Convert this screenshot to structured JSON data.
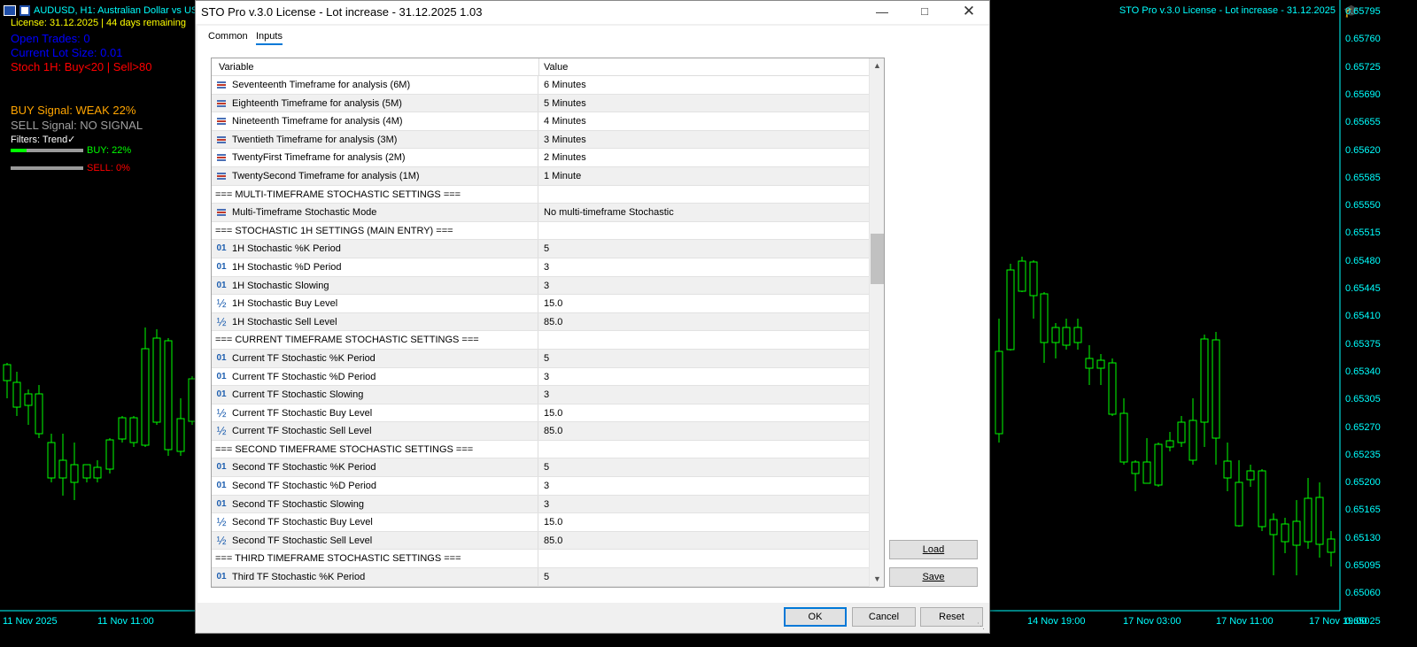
{
  "chart": {
    "header_text": "AUDUSD, H1:  Australian Dollar vs US",
    "license_text": "License: 31.12.2025 | 44 days remaining",
    "open_trades": "Open Trades: 0",
    "lot_size": "Current Lot Size: 0.01",
    "stoch_text": "Stoch 1H: Buy<20 | Sell>80",
    "buy_signal": "BUY Signal: WEAK 22%",
    "sell_signal": "SELL Signal: NO SIGNAL",
    "filters": "Filters: Trend✓",
    "buy_label": "BUY: 22%",
    "buy_percent": 22,
    "sell_label": "SELL: 0%",
    "sell_percent": 0,
    "ea_title": "STO Pro v.3.0 License - Lot increase - 31.12.2025",
    "colors": {
      "background": "#000000",
      "axis_text": "#00ffff",
      "license": "#ffff00",
      "open_trades": "#0000ff",
      "stoch": "#ff0000",
      "buy_signal": "#ffa500",
      "sell_signal": "#a0a0a0",
      "filters": "#ffffff",
      "buy": "#00ff00",
      "sell": "#ff0000",
      "candle": "#00ff00"
    },
    "price_labels": [
      "0.65795",
      "0.65760",
      "0.65725",
      "0.65690",
      "0.65655",
      "0.65620",
      "0.65585",
      "0.65550",
      "0.65515",
      "0.65480",
      "0.65445",
      "0.65410",
      "0.65375",
      "0.65340",
      "0.65305",
      "0.65270",
      "0.65235",
      "0.65200",
      "0.65165",
      "0.65130",
      "0.65095",
      "0.65060",
      "0.65025"
    ],
    "time_labels_left": [
      "11 Nov 2025",
      "11 Nov 11:00"
    ],
    "time_labels_right": [
      "14 Nov 19:00",
      "17 Nov 03:00",
      "17 Nov 11:00",
      "17 Nov 19:00"
    ]
  },
  "dialog": {
    "title": "STO Pro v.3.0 License - Lot increase - 31.12.2025 1.03",
    "minimize_icon": "minimize-icon",
    "maximize_icon": "maximize-icon",
    "close_icon": "close-icon",
    "tabs": [
      {
        "label": "Common",
        "active": false
      },
      {
        "label": "Inputs",
        "active": true
      }
    ],
    "grid": {
      "col_variable": "Variable",
      "col_value": "Value",
      "rows": [
        {
          "type": "list",
          "name": "Seventeenth Timeframe for analysis (6M)",
          "value": "6 Minutes"
        },
        {
          "type": "list",
          "name": "Eighteenth Timeframe for analysis (5M)",
          "value": "5 Minutes"
        },
        {
          "type": "list",
          "name": "Nineteenth Timeframe for analysis (4M)",
          "value": "4 Minutes"
        },
        {
          "type": "list",
          "name": "Twentieth Timeframe for analysis (3M)",
          "value": "3 Minutes"
        },
        {
          "type": "list",
          "name": "TwentyFirst Timeframe for analysis (2M)",
          "value": "2 Minutes"
        },
        {
          "type": "list",
          "name": "TwentySecond Timeframe for analysis (1M)",
          "value": "1 Minute"
        },
        {
          "type": "section",
          "name": "=== MULTI-TIMEFRAME STOCHASTIC SETTINGS ===",
          "value": ""
        },
        {
          "type": "list",
          "name": "Multi-Timeframe Stochastic Mode",
          "value": "No multi-timeframe Stochastic"
        },
        {
          "type": "section",
          "name": "=== STOCHASTIC 1H SETTINGS (MAIN ENTRY) ===",
          "value": ""
        },
        {
          "type": "int",
          "name": "1H Stochastic %K Period",
          "value": "5"
        },
        {
          "type": "int",
          "name": "1H Stochastic %D Period",
          "value": "3"
        },
        {
          "type": "int",
          "name": "1H Stochastic Slowing",
          "value": "3"
        },
        {
          "type": "double",
          "name": "1H Stochastic Buy Level",
          "value": "15.0"
        },
        {
          "type": "double",
          "name": "1H Stochastic Sell Level",
          "value": "85.0"
        },
        {
          "type": "section",
          "name": "=== CURRENT TIMEFRAME STOCHASTIC SETTINGS ===",
          "value": ""
        },
        {
          "type": "int",
          "name": "Current TF Stochastic %K Period",
          "value": "5"
        },
        {
          "type": "int",
          "name": "Current TF Stochastic %D Period",
          "value": "3"
        },
        {
          "type": "int",
          "name": "Current TF Stochastic Slowing",
          "value": "3"
        },
        {
          "type": "double",
          "name": "Current TF Stochastic Buy Level",
          "value": "15.0"
        },
        {
          "type": "double",
          "name": "Current TF Stochastic Sell Level",
          "value": "85.0"
        },
        {
          "type": "section",
          "name": "=== SECOND TIMEFRAME STOCHASTIC SETTINGS ===",
          "value": ""
        },
        {
          "type": "int",
          "name": "Second TF Stochastic %K Period",
          "value": "5"
        },
        {
          "type": "int",
          "name": "Second TF Stochastic %D Period",
          "value": "3"
        },
        {
          "type": "int",
          "name": "Second TF Stochastic Slowing",
          "value": "3"
        },
        {
          "type": "double",
          "name": "Second TF Stochastic Buy Level",
          "value": "15.0"
        },
        {
          "type": "double",
          "name": "Second TF Stochastic Sell Level",
          "value": "85.0"
        },
        {
          "type": "section",
          "name": "=== THIRD TIMEFRAME STOCHASTIC SETTINGS ===",
          "value": ""
        },
        {
          "type": "int",
          "name": "Third TF Stochastic %K Period",
          "value": "5"
        }
      ]
    },
    "buttons": {
      "load": "Load",
      "save": "Save",
      "ok": "OK",
      "cancel": "Cancel",
      "reset": "Reset"
    }
  }
}
